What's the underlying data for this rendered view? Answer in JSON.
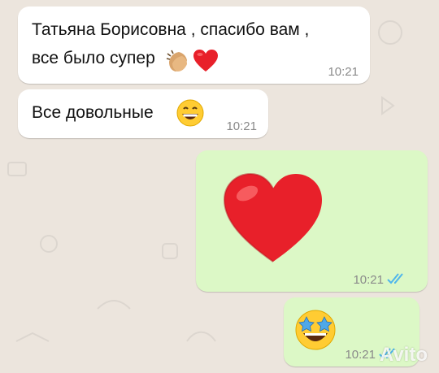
{
  "chat": {
    "messages": [
      {
        "direction": "incoming",
        "line1": "Татьяна Борисовна , спасибо вам ,",
        "line2": "все было супер",
        "emojis": [
          "clapping-hands",
          "red-heart"
        ],
        "time": "10:21"
      },
      {
        "direction": "incoming",
        "text": "Все довольные",
        "emojis": [
          "grinning-face"
        ],
        "time": "10:21"
      },
      {
        "direction": "outgoing",
        "emojis": [
          "red-heart"
        ],
        "time": "10:21",
        "status": "read"
      },
      {
        "direction": "outgoing",
        "emojis": [
          "star-struck-face"
        ],
        "time": "10:21",
        "status": "read"
      }
    ]
  },
  "watermark": {
    "text": "Avito"
  },
  "colors": {
    "background": "#ECE5DD",
    "incoming_bubble": "#FFFFFF",
    "outgoing_bubble": "#DCF8C6",
    "read_ticks": "#4FB6EC",
    "heart": "#E8202A"
  }
}
